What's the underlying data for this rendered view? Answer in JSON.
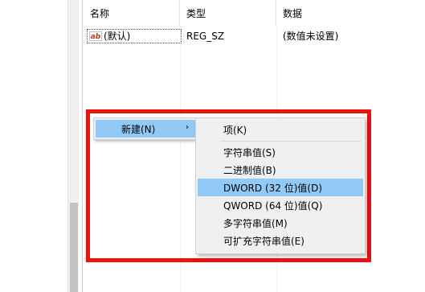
{
  "list": {
    "headers": [
      "名称",
      "类型",
      "数据"
    ],
    "row": {
      "icon": "string-value-icon",
      "icon_glyph": "ab",
      "name": "(默认)",
      "type": "REG_SZ",
      "data": "(数值未设置)"
    }
  },
  "context_menu": {
    "new_label": "新建(N)",
    "arrow": "›"
  },
  "submenu": {
    "items": [
      "项(K)",
      "字符串值(S)",
      "二进制值(B)",
      "DWORD (32 位)值(D)",
      "QWORD (64 位)值(Q)",
      "多字符串值(M)",
      "可扩充字符串值(E)"
    ]
  },
  "colors": {
    "highlight": "#91c9f7",
    "annotation_box": "#ef1010",
    "menu_bg": "#f0f0f0"
  }
}
